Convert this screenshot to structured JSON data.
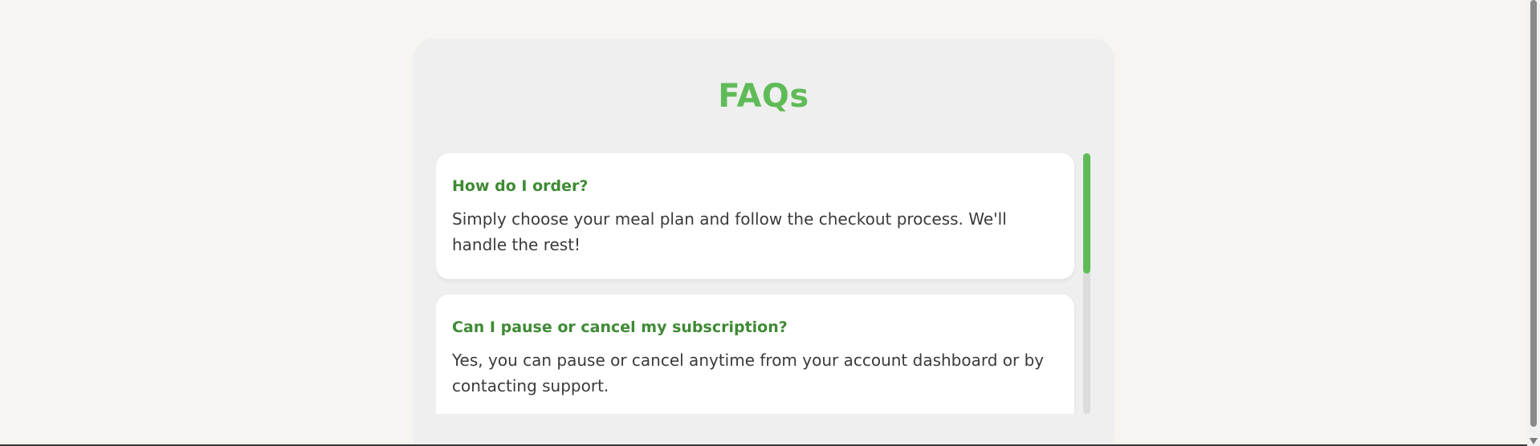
{
  "faq": {
    "title": "FAQs",
    "items": [
      {
        "question": "How do I order?",
        "answer": "Simply choose your meal plan and follow the checkout process. We'll handle the rest!"
      },
      {
        "question": "Can I pause or cancel my subscription?",
        "answer": "Yes, you can pause or cancel anytime from your account dashboard or by contacting support."
      }
    ]
  },
  "colors": {
    "accent": "#5fbb57",
    "question_text": "#3e8a34",
    "answer_text": "#3a3a3a",
    "page_background": "#f6f5f1",
    "panel_background": "#efefef"
  },
  "icons": {
    "page_scroll_down": "scroll-down-arrow-icon"
  }
}
